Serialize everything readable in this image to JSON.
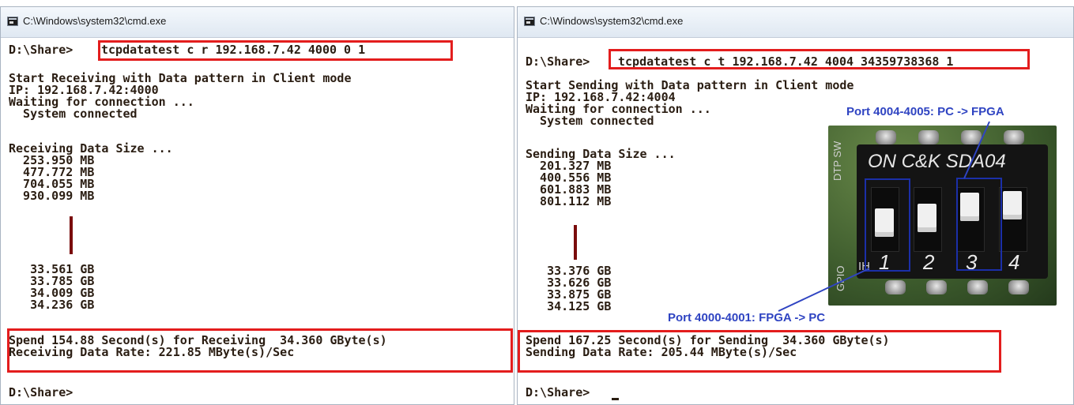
{
  "left": {
    "title": "C:\\Windows\\system32\\cmd.exe",
    "prompt": "D:\\Share>",
    "command": "tcpdatatest c r 192.168.7.42 4000 0 1",
    "lines": [
      "Start Receiving with Data pattern in Client mode",
      "IP: 192.168.7.42:4000",
      "Waiting for connection ...",
      "  System connected",
      "",
      "Receiving Data Size ...",
      "  253.950 MB",
      "  477.772 MB",
      "  704.055 MB",
      "  930.099 MB"
    ],
    "gb_lines": [
      "   33.561 GB",
      "   33.785 GB",
      "   34.009 GB",
      "   34.236 GB"
    ],
    "summary": [
      "Spend 154.88 Second(s) for Receiving  34.360 GByte(s)",
      "Receiving Data Rate: 221.85 MByte(s)/Sec"
    ],
    "final_prompt": "D:\\Share>"
  },
  "right": {
    "title": "C:\\Windows\\system32\\cmd.exe",
    "prompt": "D:\\Share>",
    "command": "tcpdatatest c t 192.168.7.42 4004 34359738368 1",
    "lines": [
      "Start Sending with Data pattern in Client mode",
      "IP: 192.168.7.42:4004",
      "Waiting for connection ...",
      "  System connected",
      "",
      "Sending Data Size ...",
      "  201.327 MB",
      "  400.556 MB",
      "  601.883 MB",
      "  801.112 MB"
    ],
    "gb_lines": [
      "   33.376 GB",
      "   33.626 GB",
      "   33.875 GB",
      "   34.125 GB"
    ],
    "summary": [
      "Spend 167.25 Second(s) for Sending  34.360 GByte(s)",
      "Sending Data Rate: 205.44 MByte(s)/Sec"
    ],
    "final_prompt": "D:\\Share>"
  },
  "photo": {
    "switch_brand": "ON C&K SDA04",
    "switch_numbers": [
      "1",
      "2",
      "3",
      "4"
    ],
    "side_text_top": "DTP SW",
    "side_text_bottom": "GPIO",
    "side_text_ih": "IH"
  },
  "annotations": {
    "top": "Port 4004-4005: PC -> FPGA",
    "bottom": "Port 4000-4001: FPGA -> PC"
  },
  "colors": {
    "console_text": "#2a1d12",
    "highlight_box": "#e31d1d",
    "annotation_blue": "#2f44c2"
  }
}
